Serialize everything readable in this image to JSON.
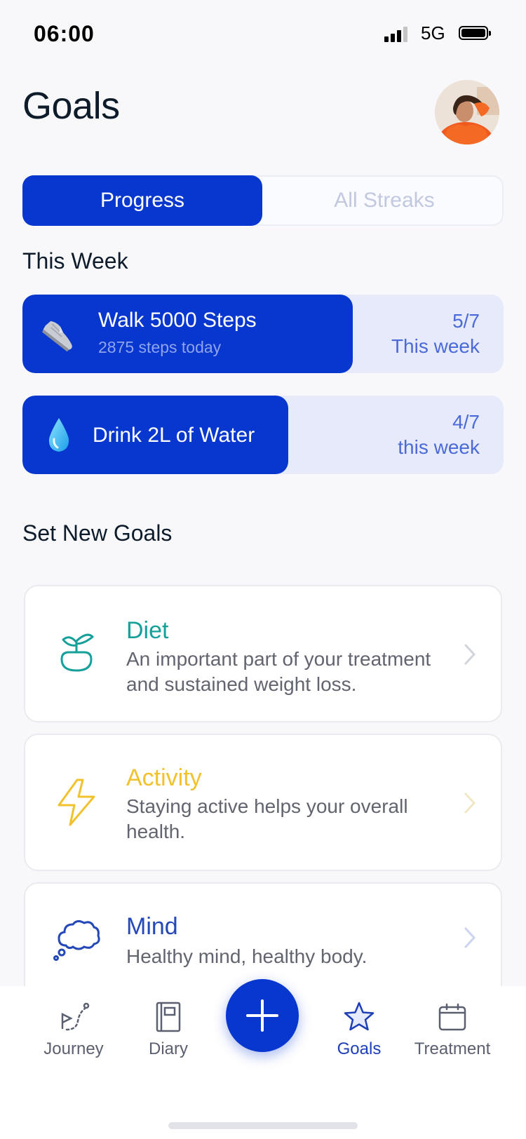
{
  "status_bar": {
    "time": "06:00",
    "network": "5G"
  },
  "header": {
    "title": "Goals"
  },
  "tabs": {
    "progress": "Progress",
    "all_streaks": "All Streaks"
  },
  "this_week": {
    "heading": "This Week",
    "goals": [
      {
        "title": "Walk 5000 Steps",
        "subtitle": "2875 steps today",
        "count": "5/7",
        "period": "This week",
        "progress_fraction": 0.686,
        "icon": "sneaker-icon"
      },
      {
        "title": "Drink 2L of Water",
        "subtitle": "",
        "count": "4/7",
        "period": "this week",
        "progress_fraction": 0.553,
        "icon": "water-drop-icon"
      }
    ]
  },
  "set_new_goals": {
    "heading": "Set New Goals",
    "items": [
      {
        "title": "Diet",
        "description": "An important part of your treatment and sustained weight loss.",
        "color": "#16a09a",
        "icon": "plant-pot-icon"
      },
      {
        "title": "Activity",
        "description": "Staying active helps your overall health.",
        "color": "#f2c12e",
        "icon": "lightning-icon"
      },
      {
        "title": "Mind",
        "description": "Healthy mind, healthy body.",
        "color": "#2548b8",
        "icon": "thought-cloud-icon"
      }
    ]
  },
  "bottom_nav": {
    "journey": "Journey",
    "diary": "Diary",
    "goals": "Goals",
    "treatment": "Treatment",
    "active": "Goals"
  },
  "colors": {
    "primary": "#0737cf",
    "track": "#e6eafb",
    "background": "#f8f8fb"
  }
}
